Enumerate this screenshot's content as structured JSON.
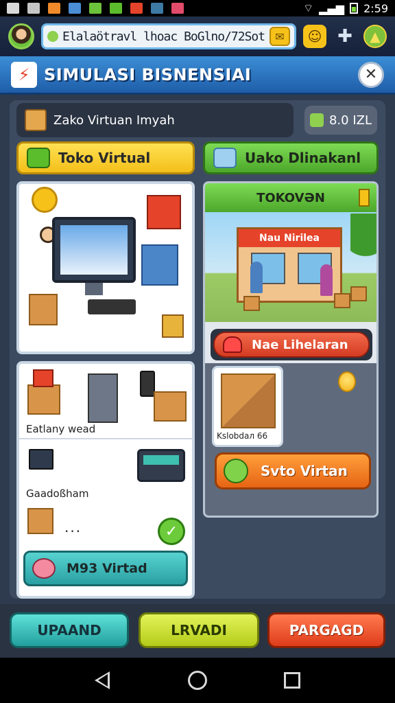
{
  "status_bar": {
    "time": "2:59"
  },
  "top_bar": {
    "url_text": "Elalaötravl lhoac BoGlno/72Sot"
  },
  "title_bar": {
    "title": "SIMULASI BISNENSIAI",
    "close_symbol": "✕"
  },
  "shop": {
    "name": "Zako Virtuan Imyah",
    "balance": "8.0 IZL"
  },
  "tabs": [
    {
      "label": "Toko Virtual"
    },
    {
      "label": "Uako Dlinakanl"
    }
  ],
  "store_card": {
    "header": "TOKOVƏN",
    "shop_sign": "Nau Nirilea",
    "buy_button": "Nae Lihelaran",
    "thumb_label": "Kslobdaл 66",
    "action_button": "Svto Virtan"
  },
  "list_card": {
    "row1_label": "Eatlany wead",
    "row2_label": "Gaadoßham",
    "ellipsis": "...",
    "check_symbol": "✓",
    "button": "M93 Virtad"
  },
  "action_bar": {
    "left": "UPAAND",
    "middle": "LRVADI",
    "right": "PARGAGD"
  },
  "colors": {
    "title_bar": "#2f78c8",
    "tab_yellow": "#f4bf19",
    "tab_green": "#4ca72b",
    "teal": "#2a9fa3",
    "orange": "#e66414",
    "red": "#de3c1a"
  },
  "icons": {
    "status": [
      "notification-icon",
      "image-icon",
      "game-icon",
      "app-icon",
      "note-icon",
      "wifi-icon",
      "signal-icon",
      "battery-icon"
    ],
    "top": [
      "avatar",
      "smiley-icon",
      "puzzle-icon",
      "level-up-icon"
    ]
  }
}
